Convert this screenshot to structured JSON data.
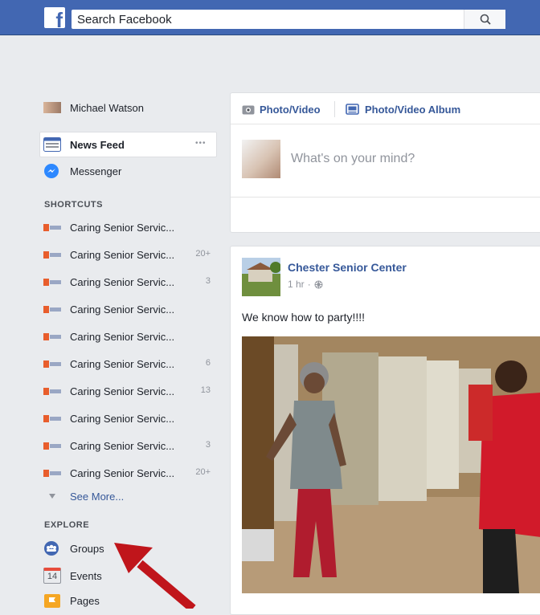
{
  "topbar": {
    "logo_letter": "f",
    "search_placeholder": "Search Facebook"
  },
  "sidebar": {
    "profile_name": "Michael Watson",
    "news_feed": "News Feed",
    "news_feed_more": "•••",
    "messenger": "Messenger",
    "shortcuts_heading": "SHORTCUTS",
    "shortcuts": [
      {
        "label": "Caring Senior Servic...",
        "count": ""
      },
      {
        "label": "Caring Senior Servic...",
        "count": "20+"
      },
      {
        "label": "Caring Senior Servic...",
        "count": "3"
      },
      {
        "label": "Caring Senior Servic...",
        "count": ""
      },
      {
        "label": "Caring Senior Servic...",
        "count": ""
      },
      {
        "label": "Caring Senior Servic...",
        "count": "6"
      },
      {
        "label": "Caring Senior Servic...",
        "count": "13"
      },
      {
        "label": "Caring Senior Servic...",
        "count": ""
      },
      {
        "label": "Caring Senior Servic...",
        "count": "3"
      },
      {
        "label": "Caring Senior Servic...",
        "count": "20+"
      }
    ],
    "see_more": "See More...",
    "explore_heading": "EXPLORE",
    "groups": "Groups",
    "events": "Events",
    "events_day": "14",
    "pages": "Pages"
  },
  "composer": {
    "photo_video": "Photo/Video",
    "photo_video_album": "Photo/Video Album",
    "placeholder": "What's on your mind?"
  },
  "post": {
    "author": "Chester Senior Center",
    "time": "1 hr",
    "separator": "·",
    "text": "We know how to party!!!!"
  },
  "colors": {
    "brand_blue": "#4267b2",
    "link_blue": "#365899",
    "annotation_arrow": "#c0151b"
  }
}
